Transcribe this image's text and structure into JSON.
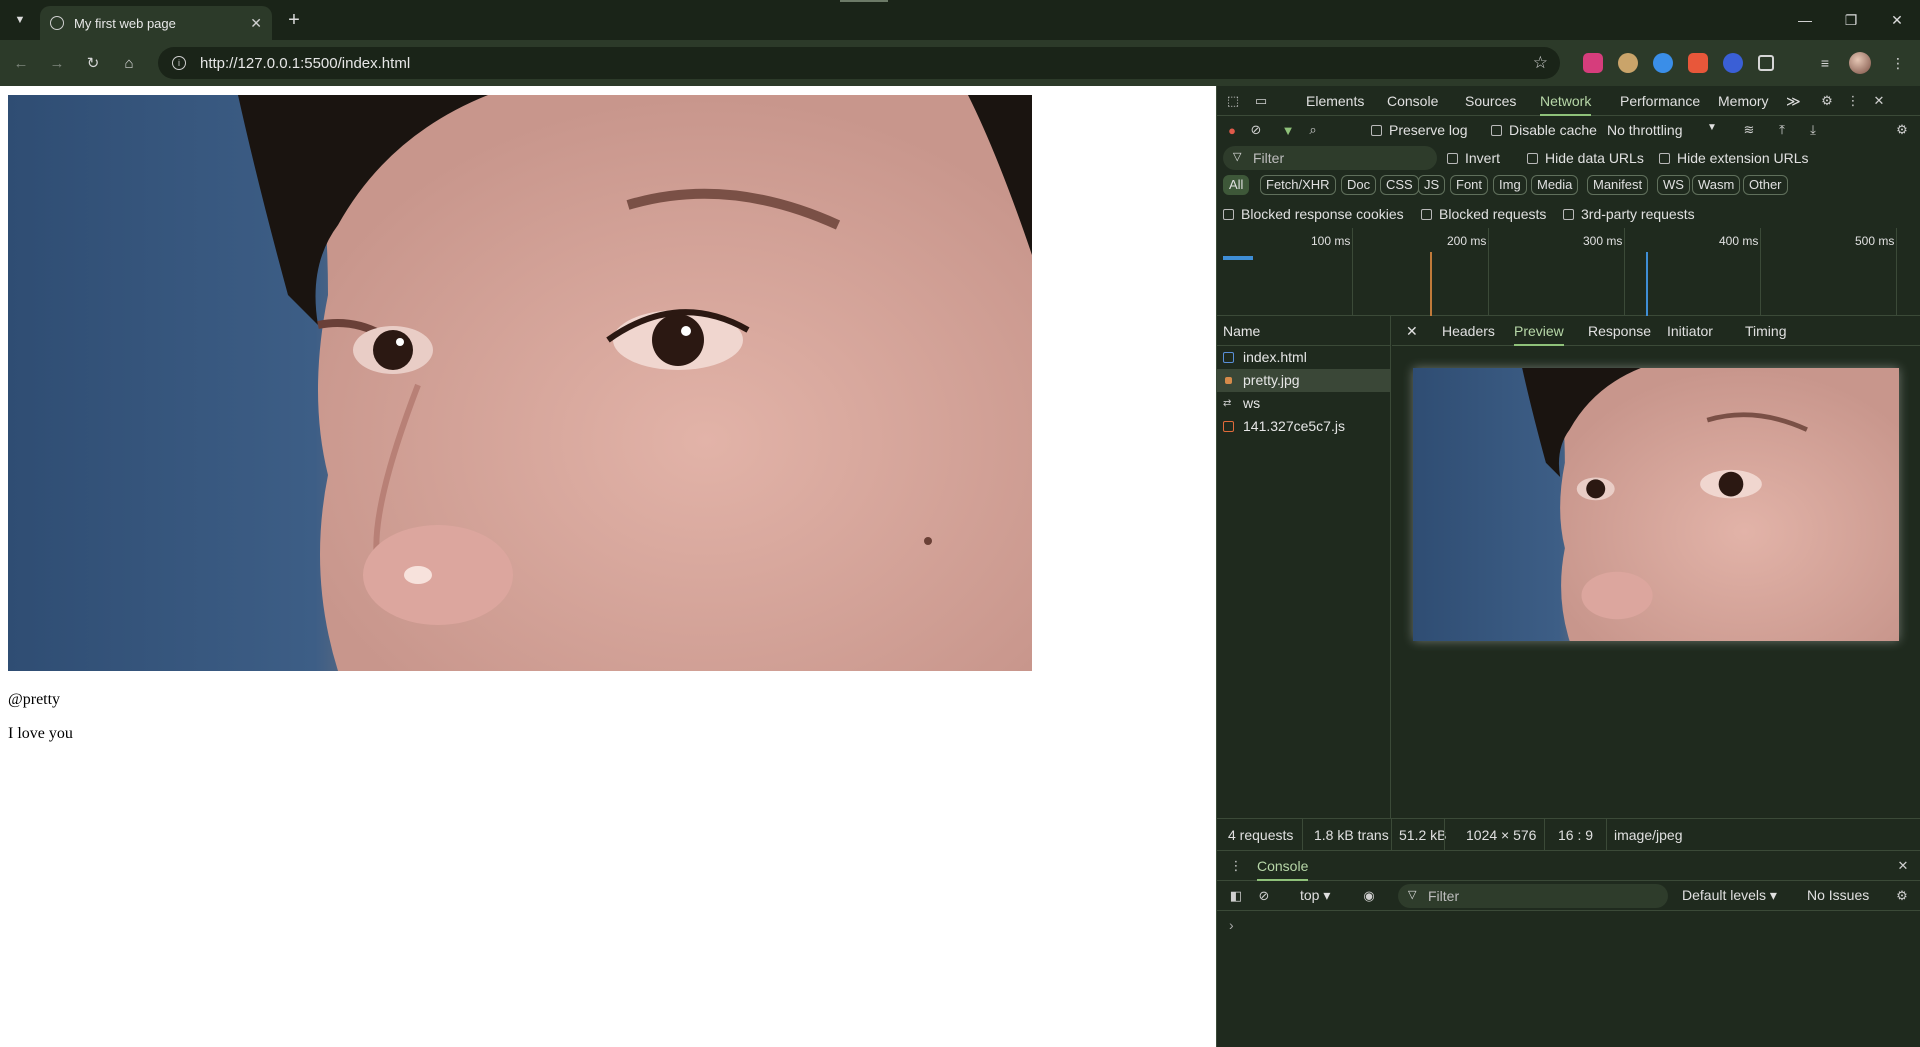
{
  "tab": {
    "title": "My first web page",
    "close": "✕",
    "new": "+"
  },
  "window": {
    "minimize": "—",
    "restore": "❐",
    "close": "✕"
  },
  "toolbar": {
    "url": "http://127.0.0.1:5500/index.html",
    "back": "←",
    "forward": "→",
    "reload": "↻",
    "home": "⌂",
    "star": "☆"
  },
  "page": {
    "handle": "@pretty",
    "message": "I love you"
  },
  "devtools": {
    "tabs": [
      "Elements",
      "Console",
      "Sources",
      "Network",
      "Performance",
      "Memory"
    ],
    "active_tab": "Network",
    "more": "≫",
    "network": {
      "preserve_log": "Preserve log",
      "disable_cache": "Disable cache",
      "throttling": "No throttling",
      "filter_placeholder": "Filter",
      "invert": "Invert",
      "hide_data_urls": "Hide data URLs",
      "hide_extension_urls": "Hide extension URLs",
      "type_filters": [
        "All",
        "Fetch/XHR",
        "Doc",
        "CSS",
        "JS",
        "Font",
        "Img",
        "Media",
        "Manifest",
        "WS",
        "Wasm",
        "Other"
      ],
      "blocked_response_cookies": "Blocked response cookies",
      "blocked_requests": "Blocked requests",
      "third_party": "3rd-party requests",
      "timeline_ticks": [
        "100 ms",
        "200 ms",
        "300 ms",
        "400 ms",
        "500 ms"
      ],
      "name_header": "Name",
      "requests": [
        {
          "name": "index.html",
          "icon": "document-icon",
          "color": "#5a8fd8"
        },
        {
          "name": "pretty.jpg",
          "icon": "image-icon",
          "color": "#d68a4a"
        },
        {
          "name": "ws",
          "icon": "websocket-icon",
          "color": "#c9c9c9"
        },
        {
          "name": "141.327ce5c7.js",
          "icon": "script-icon",
          "color": "#e06a3a"
        }
      ],
      "selected_request": "pretty.jpg",
      "detail_tabs": [
        "Headers",
        "Preview",
        "Response",
        "Initiator",
        "Timing"
      ],
      "active_detail_tab": "Preview",
      "status": {
        "requests": "4 requests",
        "transferred": "1.8 kB trans",
        "size": "51.2 kB",
        "dimensions": "1024 × 576",
        "ratio": "16 : 9",
        "mime": "image/jpeg"
      }
    },
    "console": {
      "tab": "Console",
      "context": "top ▾",
      "filter_placeholder": "Filter",
      "levels": "Default levels ▾",
      "issues": "No Issues",
      "prompt": "›"
    }
  },
  "colors": {
    "accent": "#8fc27a",
    "devtools_bg": "#1f2a1e",
    "chrome_bg": "#2c3a29"
  }
}
